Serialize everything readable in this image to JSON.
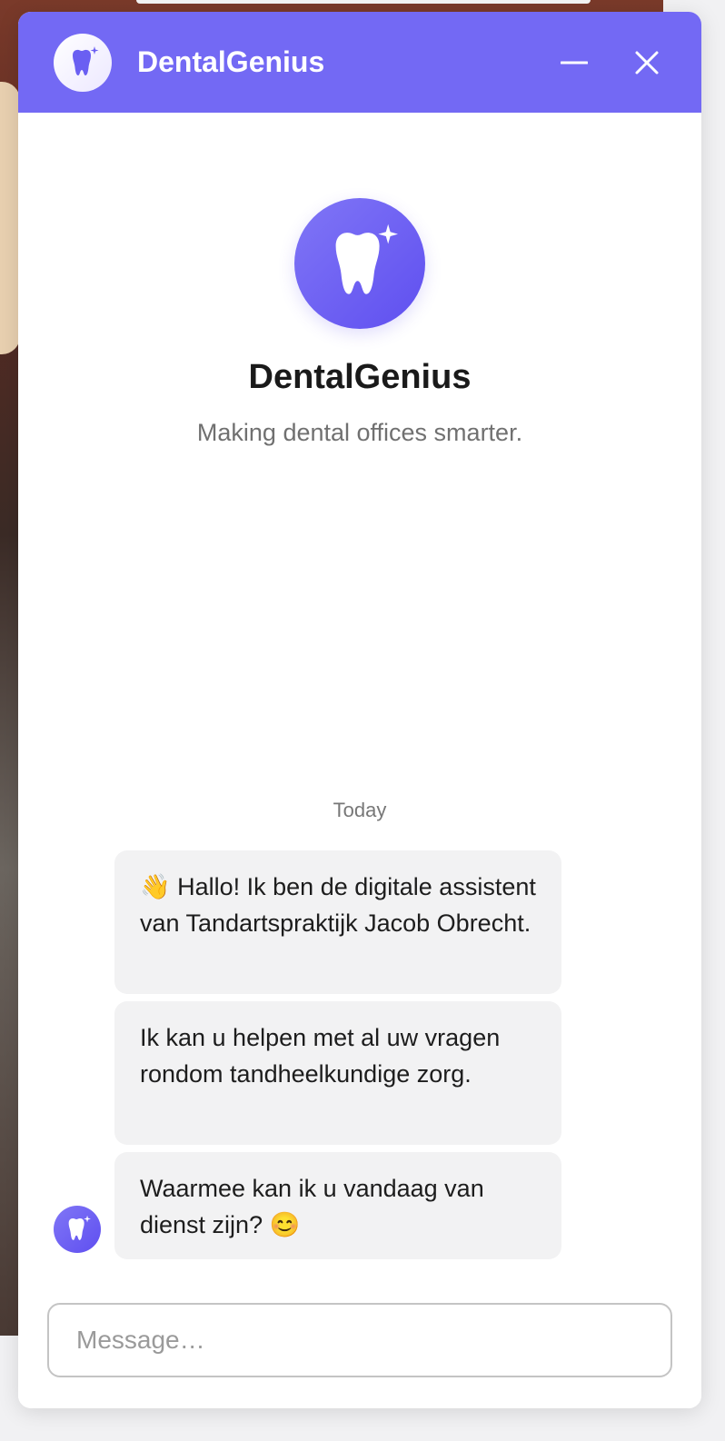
{
  "header": {
    "title": "DentalGenius",
    "avatar_icon": "tooth-sparkle-icon",
    "minimize_icon": "minimize-icon",
    "close_icon": "close-icon"
  },
  "intro": {
    "avatar_icon": "tooth-sparkle-icon",
    "title": "DentalGenius",
    "subtitle": "Making dental offices smarter."
  },
  "conversation": {
    "day_label": "Today",
    "messages": [
      {
        "sender": "bot",
        "text": "👋 Hallo! Ik ben de digitale assistent van Tandartspraktijk Jacob Obrecht."
      },
      {
        "sender": "bot",
        "text": "Ik kan u helpen met al uw vragen rondom tandheelkundige zorg."
      },
      {
        "sender": "bot",
        "text": "Waarmee kan ik u vandaag van dienst zijn? 😊"
      }
    ]
  },
  "composer": {
    "placeholder": "Message…",
    "value": ""
  },
  "colors": {
    "accent": "#7369f4",
    "bubble_bg": "#f2f2f3",
    "avatar_gradient_start": "#8076f6",
    "avatar_gradient_end": "#5f4ff0"
  }
}
